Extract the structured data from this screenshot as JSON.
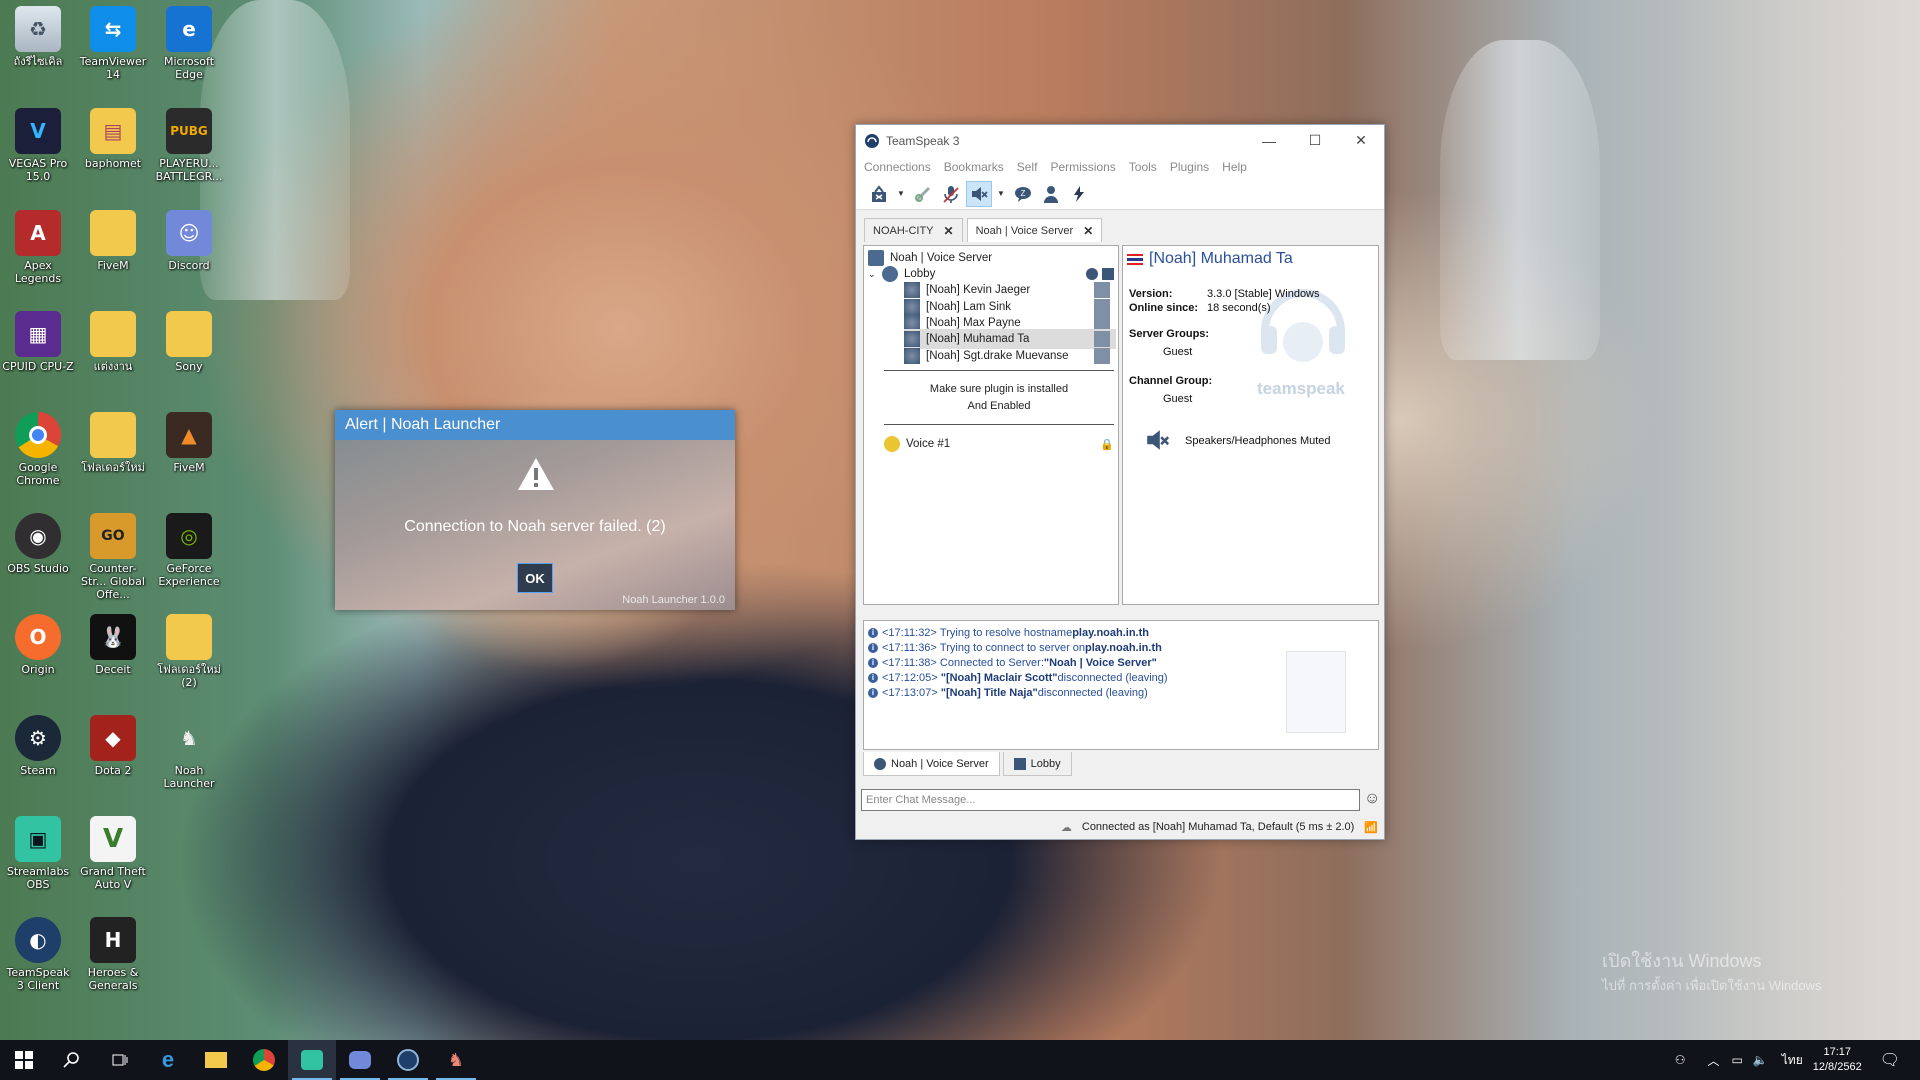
{
  "desktop": {
    "icons": [
      {
        "label": "ถังรีไซเคิล",
        "icon": "recycle-bin-icon"
      },
      {
        "label": "TeamViewer 14",
        "icon": "teamviewer-icon"
      },
      {
        "label": "Microsoft Edge",
        "icon": "edge-icon"
      },
      {
        "label": "VEGAS Pro 15.0",
        "icon": "vegas-icon"
      },
      {
        "label": "baphomet",
        "icon": "folder-icon"
      },
      {
        "label": "PLAYERU... BATTLEGR...",
        "icon": "pubg-icon"
      },
      {
        "label": "Apex Legends",
        "icon": "apex-icon"
      },
      {
        "label": "FiveM",
        "icon": "folder-icon"
      },
      {
        "label": "Discord",
        "icon": "discord-icon"
      },
      {
        "label": "CPUID CPU-Z",
        "icon": "cpuz-icon"
      },
      {
        "label": "แต่งงาน",
        "icon": "folder-icon"
      },
      {
        "label": "Sony",
        "icon": "folder-icon"
      },
      {
        "label": "Google Chrome",
        "icon": "chrome-icon"
      },
      {
        "label": "โฟลเดอร์ใหม่",
        "icon": "folder-icon"
      },
      {
        "label": "FiveM",
        "icon": "fivem-icon"
      },
      {
        "label": "OBS Studio",
        "icon": "obs-icon"
      },
      {
        "label": "Counter-Str... Global Offe...",
        "icon": "csgo-icon"
      },
      {
        "label": "GeForce Experience",
        "icon": "geforce-icon"
      },
      {
        "label": "Origin",
        "icon": "origin-icon"
      },
      {
        "label": "Deceit",
        "icon": "deceit-icon"
      },
      {
        "label": "โฟลเดอร์ใหม่ (2)",
        "icon": "folder-icon"
      },
      {
        "label": "Steam",
        "icon": "steam-icon"
      },
      {
        "label": "Dota 2",
        "icon": "dota-icon"
      },
      {
        "label": "Noah Launcher",
        "icon": "noah-icon"
      },
      {
        "label": "Streamlabs OBS",
        "icon": "streamlabs-icon"
      },
      {
        "label": "Grand Theft Auto V",
        "icon": "gta-icon"
      },
      {
        "label": "TeamSpeak 3 Client",
        "icon": "teamspeak-icon"
      },
      {
        "label": "Heroes & Generals",
        "icon": "hg-icon"
      }
    ]
  },
  "alert": {
    "title": "Alert | Noah Launcher",
    "message": "Connection to Noah server failed. (2)",
    "ok_label": "OK",
    "version": "Noah Launcher 1.0.0"
  },
  "teamspeak": {
    "title": "TeamSpeak 3",
    "menu": [
      "Connections",
      "Bookmarks",
      "Self",
      "Permissions",
      "Tools",
      "Plugins",
      "Help"
    ],
    "tabs": [
      {
        "label": "NOAH-CITY"
      },
      {
        "label": "Noah | Voice Server"
      }
    ],
    "tree": {
      "server": "Noah | Voice Server",
      "lobby": "Lobby",
      "clients": [
        "[Noah] Kevin Jaeger",
        "[Noah] Lam Sink",
        "[Noah] Max Payne",
        "[Noah] Muhamad Ta",
        "[Noah] Sgt.drake Muevanse"
      ],
      "spacer_line1": "Make sure plugin is installed",
      "spacer_line2": "And Enabled",
      "voice_channel": "Voice #1"
    },
    "info": {
      "name": "[Noah] Muhamad Ta",
      "version_label": "Version:",
      "version_value": "3.3.0 [Stable] Windows",
      "online_label": "Online since:",
      "online_value": "18 second(s)",
      "server_groups_label": "Server Groups:",
      "server_groups_value": "Guest",
      "channel_group_label": "Channel Group:",
      "channel_group_value": "Guest",
      "status_text": "Speakers/Headphones Muted",
      "logo_text": "teamspeak"
    },
    "log": [
      {
        "time": "<17:11:32>",
        "text": "Trying to resolve hostname ",
        "bold": "play.noah.in.th",
        "tail": ""
      },
      {
        "time": "<17:11:36>",
        "text": "Trying to connect to server on ",
        "bold": "play.noah.in.th",
        "tail": ""
      },
      {
        "time": "<17:11:38>",
        "text": "Connected to Server: ",
        "bold": "\"Noah | Voice Server\"",
        "tail": ""
      },
      {
        "time": "<17:12:05>",
        "text": "",
        "bold": "\"[Noah] Maclair Scott\"",
        "tail": " disconnected (leaving)"
      },
      {
        "time": "<17:13:07>",
        "text": "",
        "bold": "\"[Noah] Title Naja\"",
        "tail": " disconnected (leaving)"
      }
    ],
    "chat_tabs": [
      "Noah | Voice Server",
      "Lobby"
    ],
    "chat_placeholder": "Enter Chat Message...",
    "status": "Connected as [Noah] Muhamad Ta, Default (5 ms ± 2.0)"
  },
  "taskbar": {
    "language": "ไทย",
    "time": "17:17",
    "date": "12/8/2562"
  },
  "watermark": {
    "line1": "เปิดใช้งาน Windows",
    "line2": "ไปที่ การตั้งค่า เพื่อเปิดใช้งาน Windows"
  }
}
